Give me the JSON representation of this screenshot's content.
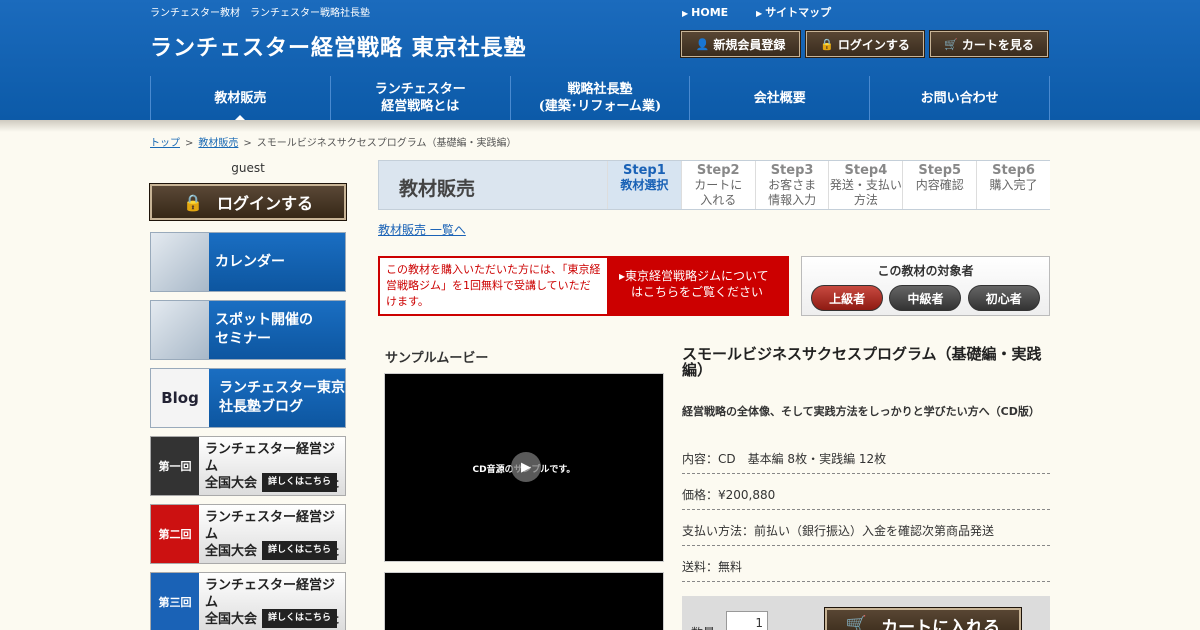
{
  "header": {
    "tagline": "ランチェスター教材　ランチェスター戦略社長塾",
    "site_title": "ランチェスター経営戦略 東京社長塾",
    "links": [
      "HOME",
      "サイトマップ"
    ],
    "buttons": {
      "register": "新規会員登録",
      "login": "ログインする",
      "cart": "カートを見る"
    },
    "nav": [
      {
        "label": "教材販売"
      },
      {
        "label": "ランチェスター\n経営戦略とは"
      },
      {
        "label": "戦略社長塾\n(建築･リフォーム業)"
      },
      {
        "label": "会社概要"
      },
      {
        "label": "お問い合わせ"
      }
    ]
  },
  "breadcrumb": {
    "home": "トップ",
    "category": "教材販売",
    "current": "スモールビジネスサクセスプログラム（基礎編・実践編）"
  },
  "sidebar": {
    "user": "guest",
    "login": "ログインする",
    "banners": [
      {
        "label": "カレンダー",
        "thumb": ""
      },
      {
        "label": "スポット開催の\nセミナー",
        "thumb": ""
      },
      {
        "label": "ランチェスター東京\n社長塾ブログ",
        "thumb": "Blog"
      }
    ],
    "events": [
      {
        "num": "第一回",
        "text": "ランチェスター経営ジム\n全国大会 開催しました",
        "more": "詳しくはこちら",
        "color": "#333333"
      },
      {
        "num": "第二回",
        "text": "ランチェスター経営ジム\n全国大会 開催しました",
        "more": "詳しくはこちら",
        "color": "#cc1111"
      },
      {
        "num": "第三回",
        "text": "ランチェスター経営ジム\n全国大会 開催しました",
        "more": "詳しくはこちら",
        "color": "#1a62b6"
      }
    ]
  },
  "main": {
    "page_title": "教材販売",
    "steps": [
      {
        "num": "Step1",
        "label": "教材選択"
      },
      {
        "num": "Step2",
        "label": "カートに\n入れる"
      },
      {
        "num": "Step3",
        "label": "お客さま\n情報入力"
      },
      {
        "num": "Step4",
        "label": "発送・支払い\n方法"
      },
      {
        "num": "Step5",
        "label": "内容確認"
      },
      {
        "num": "Step6",
        "label": "購入完了"
      }
    ],
    "list_link": "教材販売 一覧へ",
    "notice_left": "この教材を購入いただいた方には、「東京経営戦略ジム」を1回無料で受講していただけます。",
    "notice_right": "▸東京経営戦略ジムについて\n　はこちらをご覧ください",
    "target_title": "この教材の対象者",
    "levels": [
      {
        "label": "上級者",
        "color": "#b0281e"
      },
      {
        "label": "中級者",
        "color": "#444444"
      },
      {
        "label": "初心者",
        "color": "#444444"
      }
    ],
    "sample_title": "サンプルムービー",
    "video_text": "CD音源のサンプルです。",
    "product": {
      "title": "スモールビジネスサクセスプログラム（基礎編・実践編）",
      "subtitle": "経営戦略の全体像、そして実践方法をしっかりと学びたい方へ（CD版）",
      "content": "内容：CD　基本編 8枚・実践編 12枚",
      "price": "価格：¥200,880",
      "payment": "支払い方法：前払い（銀行振込）入金を確認次第商品発送",
      "shipping": "送料：無料"
    },
    "qty_label": "数量",
    "qty_value": "1",
    "add_to_cart": "カートに入れる"
  }
}
